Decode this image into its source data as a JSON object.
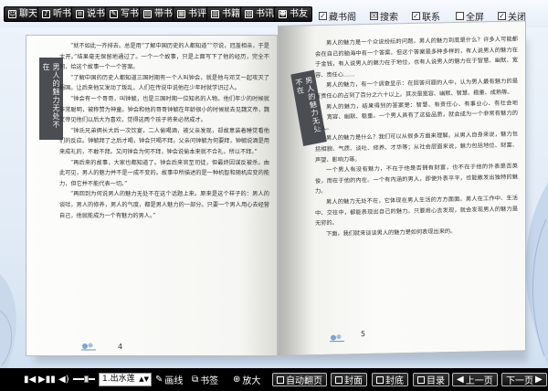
{
  "toolbar": {
    "buttons": [
      {
        "label": "聊天",
        "icon": "chat-icon"
      },
      {
        "label": "听书",
        "icon": "headphones-icon"
      },
      {
        "label": "说书",
        "icon": "speech-icon"
      },
      {
        "label": "写书",
        "icon": "pen-icon"
      },
      {
        "label": "带书",
        "icon": "book-carry-icon"
      },
      {
        "label": "书评",
        "icon": "review-icon"
      },
      {
        "label": "书籍",
        "icon": "books-icon"
      },
      {
        "label": "书讯",
        "icon": "news-icon"
      },
      {
        "label": "书友",
        "icon": "friends-icon"
      }
    ],
    "checks": [
      {
        "label": "藏书阁",
        "checked": true
      },
      {
        "label": "搜索",
        "checked": false
      },
      {
        "label": "联系",
        "checked": true
      },
      {
        "label": "全屏",
        "checked": false
      },
      {
        "label": "关闭",
        "checked": true
      }
    ]
  },
  "book": {
    "left_tab": "男人的魅力无处不在",
    "right_tab": "男人的魅力无处不在",
    "left_page_number": "4",
    "right_page_number": "5",
    "left_text": [
      "“就不如此一齐排去。总是用“了解中国历史的人都知道”“尔说，冠盖相亲，于是大开。”结果毫无保留地通过了。一个一个故事，只是上面写下了他的经历，完全不同，给这个故事一个一个答案。",
      "“了解中国的历史人都知道三国时期有一个人叫钟会，就是他与邓艾一起攻灭了蜀国。让后来他又发动了叛乱，人们在传说中说他在少年时就学识过人。",
      "“钟会有一个哥哥，叫钟毓，也是三国时期一位知名的人物。他们年少的时候就非常聪明，被称赞为神童。钟会和他的哥哥钟毓在年龄很小的时候就去见魏文帝，魏文帝见他们以后大为喜欢，觉得这两个孩子将来必然成才。",
      "“钟氏兄弟俩长大后一次饮宴，二人偷喝酒，被父亲发现，却故意装着睡觉看他们的反应。钟毓拜了之后才喝，钟会只喝不拜。父亲问钟毓为何要拜，钟毓说酒是用来成礼的，不敢不拜。又问钟会为何不拜，钟会说偷本来就不合礼，所以不拜。”",
      "“再后来的故事，大家也都知道了。钟会后来官至司徒，但最终因谋反被杀。由此可见，男人的魅力并不是一成不变的。故事中所描述的是一种机智和随机应变的能力，但它并不能代表一切。”",
      "“再回到为何说男人的魅力无处不在这个话题上来。原来是这个样子的：男人的谈吐，男人的修养，男人的气度，都是男人魅力的一部分。只要一个男人用心去经营自己，他就能成为一个有魅力的男人。”"
    ],
    "right_text": [
      "男人的魅力是一个众说纷纭的问题。男人的魅力到底是什么？许多人可能都会在自己的脑海中有一个答案。但这个答案是多种多样的，有人说男人的魅力在于金钱，有人说男人的魅力在于地位，也有人说男人的魅力在于智慧、幽默、宽容、责任心……",
      "男人的魅力，有一个调查显示：在回答问题的人中，认为男人最有魅力的是有责任心的占到了百分之六十以上。其次是宽容、幽默、智慧、稳重、成熟等。",
      "男人的魅力，结果得到的答案是：智慧、有责任心、有事业心、有社会地位、宽容、幽默、稳重。一个男人具有了这些品质，就会成为一个非常有魅力的男人。",
      "男人的魅力是什么？我们可以从很多方面来理解。从男人自身来说，魅力包括相貌、气质、谈吐、修养、才华等；从社会层面来说，魅力包括地位、财富、声望、影响力等。",
      "一个男人有没有魅力，不在于他是否拥有财富，也不在于他的外表是否英俊，而在于他的内在。一个有内涵的男人，即使外表平平，也能散发出独特的魅力。",
      "男人的魅力无处不在，它体现在男人生活的方方面面。男人在工作中、生活中、交往中，都能表现出自己的魅力。只要用心去发现，就会发现男人的魅力是无穷的。",
      "下面，我们就来谈谈男人的魅力是如何表现出来的。"
    ]
  },
  "bottombar": {
    "track": "1.出水莲",
    "buttons": [
      {
        "label": "画线",
        "icon": "pencil-icon"
      },
      {
        "label": "书签",
        "icon": "bookmark-icon"
      },
      {
        "label": "放大",
        "icon": "zoom-icon"
      },
      {
        "label": "自动翻页",
        "icon": "autoflip-icon"
      },
      {
        "label": "封面",
        "icon": "cover-icon"
      },
      {
        "label": "封底",
        "icon": "backcover-icon"
      },
      {
        "label": "目录",
        "icon": "toc-icon"
      },
      {
        "label": "上一页",
        "icon": "prev-icon"
      },
      {
        "label": "下一页",
        "icon": "next-icon"
      }
    ]
  },
  "colors": {
    "toolbar_bg": "#e6eef8",
    "button_bg": "#111111",
    "bottombar_bg": "#000000",
    "page_bg": "#fbfbf9",
    "side_tab_bg": "#4a4d52"
  }
}
